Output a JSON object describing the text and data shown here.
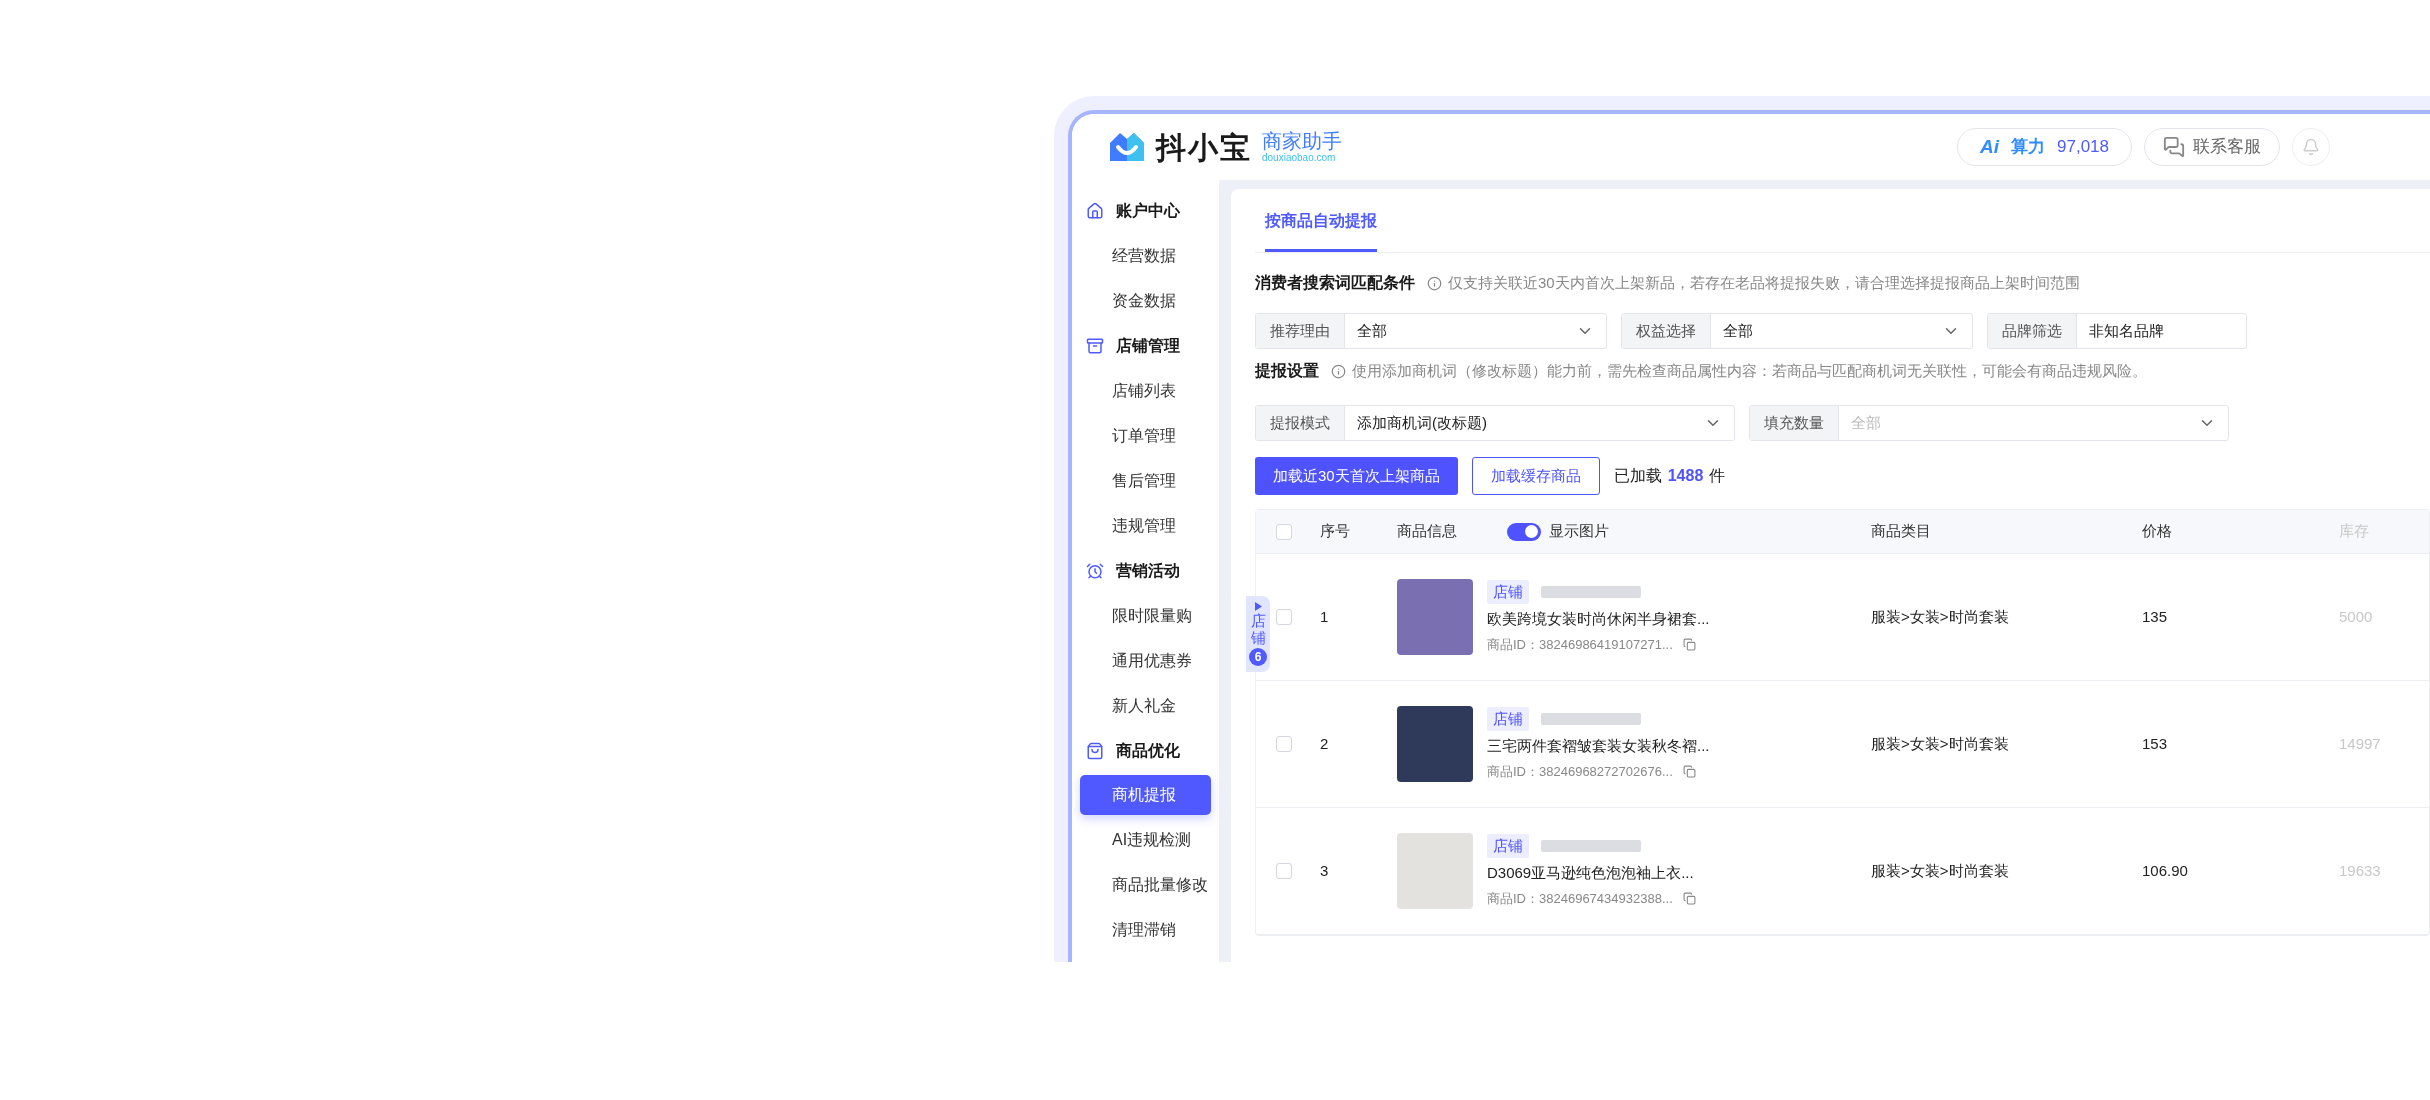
{
  "header": {
    "logo_name": "抖小宝",
    "logo_subtitle": "商家助手",
    "logo_url": "douxiaobao.com",
    "ai_mark": "Ai",
    "ai_label": "算力",
    "ai_value": "97,018",
    "support": "联系客服"
  },
  "sidebar": {
    "sections": [
      {
        "label": "账户中心",
        "children": [
          {
            "label": "经营数据",
            "selected": false
          },
          {
            "label": "资金数据",
            "selected": false
          }
        ]
      },
      {
        "label": "店铺管理",
        "children": [
          {
            "label": "店铺列表",
            "selected": false
          },
          {
            "label": "订单管理",
            "selected": false
          },
          {
            "label": "售后管理",
            "selected": false
          },
          {
            "label": "违规管理",
            "selected": false
          }
        ]
      },
      {
        "label": "营销活动",
        "children": [
          {
            "label": "限时限量购",
            "selected": false
          },
          {
            "label": "通用优惠券",
            "selected": false
          },
          {
            "label": "新人礼金",
            "selected": false
          }
        ]
      },
      {
        "label": "商品优化",
        "children": [
          {
            "label": "商机提报",
            "selected": true
          },
          {
            "label": "AI违规检测",
            "selected": false
          },
          {
            "label": "商品批量修改",
            "selected": false
          },
          {
            "label": "清理滞销",
            "selected": false
          }
        ]
      }
    ]
  },
  "shop_tab": {
    "label": "店铺",
    "count": "6"
  },
  "tabs": [
    {
      "label": "按商品自动提报",
      "selected": true
    }
  ],
  "match_section": {
    "title": "消费者搜索词匹配条件",
    "note": "仅支持关联近30天内首次上架新品，若存在老品将提报失败，请合理选择提报商品上架时间范围",
    "filters": [
      {
        "label": "推荐理由",
        "value": "全部",
        "caret": true
      },
      {
        "label": "权益选择",
        "value": "全部",
        "caret": true
      },
      {
        "label": "品牌筛选",
        "value": "非知名品牌",
        "caret": false
      }
    ]
  },
  "settings": {
    "title": "提报设置",
    "note": "使用添加商机词（修改标题）能力前，需先检查商品属性内容：若商品与匹配商机词无关联性，可能会有商品违规风险。",
    "fields": [
      {
        "label": "提报模式",
        "value": "添加商机词(改标题)"
      },
      {
        "label": "填充数量",
        "placeholder": "全部"
      }
    ]
  },
  "actions": {
    "primary": "加载近30天首次上架商品",
    "secondary": "加载缓存商品",
    "loaded_label": "已加载",
    "loaded_count": "1488",
    "loaded_unit": "件"
  },
  "table": {
    "select_all": {
      "checked": false
    },
    "columns": [
      "序号",
      "商品信息",
      "商品类目",
      "价格",
      "库存"
    ],
    "show_images": {
      "label": "显示图片",
      "on": true
    },
    "rows": [
      {
        "checked": false,
        "index": "1",
        "tag": "店铺",
        "title": "欧美跨境女装时尚休闲半身裙套...",
        "product_id": "商品ID：38246986419107271...",
        "category": "服装>女装>时尚套装",
        "price": "135",
        "stock": "5000"
      },
      {
        "checked": false,
        "index": "2",
        "tag": "店铺",
        "title": "三宅两件套褶皱套装女装秋冬褶...",
        "product_id": "商品ID：38246968272702676...",
        "category": "服装>女装>时尚套装",
        "price": "153",
        "stock": "14997"
      },
      {
        "checked": false,
        "index": "3",
        "tag": "店铺",
        "title": "D3069亚马逊纯色泡泡袖上衣...",
        "product_id": "商品ID：38246967434932388...",
        "category": "服装>女装>时尚套装",
        "price": "106.90",
        "stock": "19633"
      }
    ]
  }
}
